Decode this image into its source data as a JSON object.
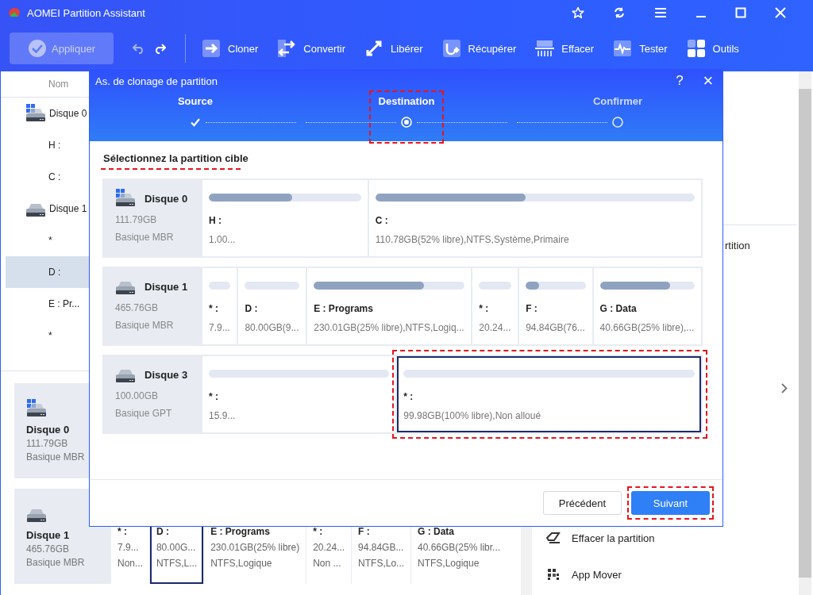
{
  "window": {
    "title": "AOMEI Partition Assistant"
  },
  "toolbar": {
    "apply": {
      "label": "Appliquer",
      "disabled": true
    },
    "tools": [
      {
        "label": "Cloner"
      },
      {
        "label": "Convertir"
      },
      {
        "label": "Libérer"
      },
      {
        "label": "Récupérer"
      },
      {
        "label": "Effacer"
      },
      {
        "label": "Tester"
      },
      {
        "label": "Outils"
      }
    ]
  },
  "tree": {
    "header": "Nom",
    "items": [
      {
        "label": "Disque 0",
        "system": true,
        "selected": false,
        "children": [
          {
            "label": "H :",
            "selected": false
          },
          {
            "label": "C :",
            "selected": false
          }
        ]
      },
      {
        "label": "Disque 1",
        "system": false,
        "selected": false,
        "children": [
          {
            "label": "*",
            "selected": false
          },
          {
            "label": "D :",
            "selected": true
          },
          {
            "label": "E : Pr...",
            "selected": false
          },
          {
            "label": "*",
            "selected": false
          }
        ]
      }
    ]
  },
  "disk_map": {
    "disks": [
      {
        "name": "Disque 0",
        "size": "111.79GB",
        "type": "Basique MBR",
        "system": true
      },
      {
        "name": "Disque 1",
        "size": "465.76GB",
        "type": "Basique MBR",
        "system": false,
        "partitions": [
          {
            "name": "* :",
            "size": "7.9...",
            "info": "Non...",
            "selected": false
          },
          {
            "name": "D :",
            "size": "80.00G...",
            "info": "NTFS,L...",
            "selected": true
          },
          {
            "name": "E : Programs",
            "size": "230.01GB(25% libre)",
            "info": "NTFS,Logique",
            "selected": false
          },
          {
            "name": "* :",
            "size": "20.24...",
            "info": "Non ...",
            "selected": false
          },
          {
            "name": "F :",
            "size": "94.84GB...",
            "info": "NTFS,Lo...",
            "selected": false
          },
          {
            "name": "G : Data",
            "size": "40.66GB(25% libr...",
            "info": "NTFS,Logique",
            "selected": false
          }
        ]
      }
    ]
  },
  "right_panel": {
    "fragments": [
      "rtition"
    ],
    "actions": [
      {
        "label": "Effacer la partition"
      },
      {
        "label": "App Mover"
      }
    ]
  },
  "dialog": {
    "title": "As. de clonage de partition",
    "help": "?",
    "close": "×",
    "steps": [
      {
        "label": "Source",
        "completed": true,
        "selected": false,
        "highlighted": false
      },
      {
        "label": "Destination",
        "completed": false,
        "selected": true,
        "highlighted": true
      },
      {
        "label": "Confirmer",
        "completed": false,
        "selected": false,
        "highlighted": false
      }
    ],
    "heading": {
      "text": "Sélectionnez la partition cible",
      "highlighted": true
    },
    "disks": [
      {
        "name": "Disque 0",
        "size": "111.79GB",
        "type": "Basique MBR",
        "system": true,
        "partitions": [
          {
            "name": "H :",
            "info": "1.00...",
            "level": 0.55,
            "selected": false,
            "highlighted": false
          },
          {
            "name": "C :",
            "info": "110.78GB(52% libre),NTFS,Système,Primaire",
            "level": 0.47,
            "selected": false,
            "highlighted": false
          }
        ]
      },
      {
        "name": "Disque 1",
        "size": "465.76GB",
        "type": "Basique MBR",
        "system": false,
        "partitions": [
          {
            "name": "* :",
            "info": "7.9...",
            "level": 0,
            "selected": false,
            "highlighted": false
          },
          {
            "name": "D :",
            "info": "80.00GB(9...",
            "level": 0,
            "selected": false,
            "highlighted": false
          },
          {
            "name": "E : Programs",
            "info": "230.01GB(25% libre),NTFS,Logiq...",
            "level": 0.73,
            "selected": false,
            "highlighted": false
          },
          {
            "name": "* :",
            "info": "20.24...",
            "level": 0,
            "selected": false,
            "highlighted": false
          },
          {
            "name": "F :",
            "info": "94.84GB(76...",
            "level": 0.22,
            "selected": false,
            "highlighted": false
          },
          {
            "name": "G : Data",
            "info": "40.66GB(25% libre),...",
            "level": 0.74,
            "selected": false,
            "highlighted": false
          }
        ]
      },
      {
        "name": "Disque 3",
        "size": "100.00GB",
        "type": "Basique GPT",
        "system": false,
        "partitions": [
          {
            "name": "* :",
            "info": "15.9...",
            "level": 0,
            "selected": false,
            "highlighted": false
          },
          {
            "name": "* :",
            "info": "99.98GB(100% libre),Non alloué",
            "level": 0,
            "selected": true,
            "highlighted": true
          }
        ]
      }
    ],
    "buttons": [
      {
        "label": "Précédent",
        "kind": "secondary",
        "highlighted": false
      },
      {
        "label": "Suivant",
        "kind": "primary",
        "highlighted": true
      }
    ]
  }
}
